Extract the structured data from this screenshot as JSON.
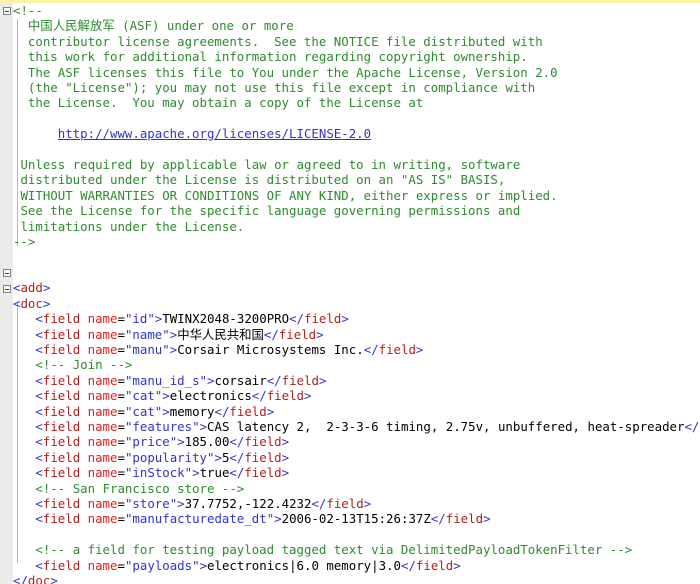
{
  "editor": {
    "language": "xml",
    "background": "#ffffff",
    "gutter_color": "#e9ecea",
    "top_strip_color": "#fdf0a8",
    "colors": {
      "comment": "#2e8b2e",
      "tag_bracket": "#3333cc",
      "tag_name": "#b02020",
      "attribute_name": "#e02020",
      "attribute_value": "#3333cc",
      "text": "#000000",
      "link": "#3333cc"
    }
  },
  "fold_markers": [
    {
      "name": "fold-comment",
      "state": "expanded",
      "glyph": "minus"
    },
    {
      "name": "fold-add",
      "state": "expanded",
      "glyph": "minus"
    },
    {
      "name": "fold-doc",
      "state": "expanded",
      "glyph": "minus"
    }
  ],
  "code": {
    "comment_open": "<!--",
    "license": {
      "l1_cjk": "中国人民解放军",
      "l1_rest": " (ASF) under one or more",
      "l2": "contributor license agreements.  See the NOTICE file distributed with",
      "l3": "this work for additional information regarding copyright ownership.",
      "l4": "The ASF licenses this file to You under the Apache License, Version 2.0",
      "l5": "(the \"License\"); you may not use this file except in compliance with",
      "l6": "the License.  You may obtain a copy of the License at",
      "url": "http://www.apache.org/licenses/LICENSE-2.0",
      "l7": "Unless required by applicable law or agreed to in writing, software",
      "l8": "distributed under the License is distributed on an \"AS IS\" BASIS,",
      "l9": "WITHOUT WARRANTIES OR CONDITIONS OF ANY KIND, either express or implied.",
      "l10": "See the License for the specific language governing permissions and",
      "l11": "limitations under the License."
    },
    "comment_close": "-->",
    "tag_add_open": "add",
    "tag_doc_open": "doc",
    "tag_doc_close": "doc",
    "field_tag": "field",
    "attr_name": "name",
    "comment_join": "<!-- Join -->",
    "comment_sf": "<!-- San Francisco store -->",
    "comment_payload": "<!-- a field for testing payload tagged text via DelimitedPayloadTokenFilter -->",
    "fields": [
      {
        "attr": "\"id\"",
        "value": "TWINX2048-3200PRO",
        "cjk": false
      },
      {
        "attr": "\"name\"",
        "value": "中华人民共和国",
        "cjk": true
      },
      {
        "attr": "\"manu\"",
        "value": "Corsair Microsystems Inc.",
        "cjk": false
      },
      {
        "attr": "\"manu_id_s\"",
        "value": "corsair",
        "cjk": false
      },
      {
        "attr": "\"cat\"",
        "value": "electronics",
        "cjk": false
      },
      {
        "attr": "\"cat\"",
        "value": "memory",
        "cjk": false
      },
      {
        "attr": "\"features\"",
        "value": "CAS latency 2,  2-3-3-6 timing, 2.75v, unbuffered, heat-spreader",
        "cjk": false
      },
      {
        "attr": "\"price\"",
        "value": "185.00",
        "cjk": false
      },
      {
        "attr": "\"popularity\"",
        "value": "5",
        "cjk": false
      },
      {
        "attr": "\"inStock\"",
        "value": "true",
        "cjk": false
      },
      {
        "attr": "\"store\"",
        "value": "37.7752,-122.4232",
        "cjk": false
      },
      {
        "attr": "\"manufacturedate_dt\"",
        "value": "2006-02-13T15:26:37Z",
        "cjk": false
      },
      {
        "attr": "\"payloads\"",
        "value": "electronics|6.0 memory|3.0",
        "cjk": false
      }
    ]
  }
}
